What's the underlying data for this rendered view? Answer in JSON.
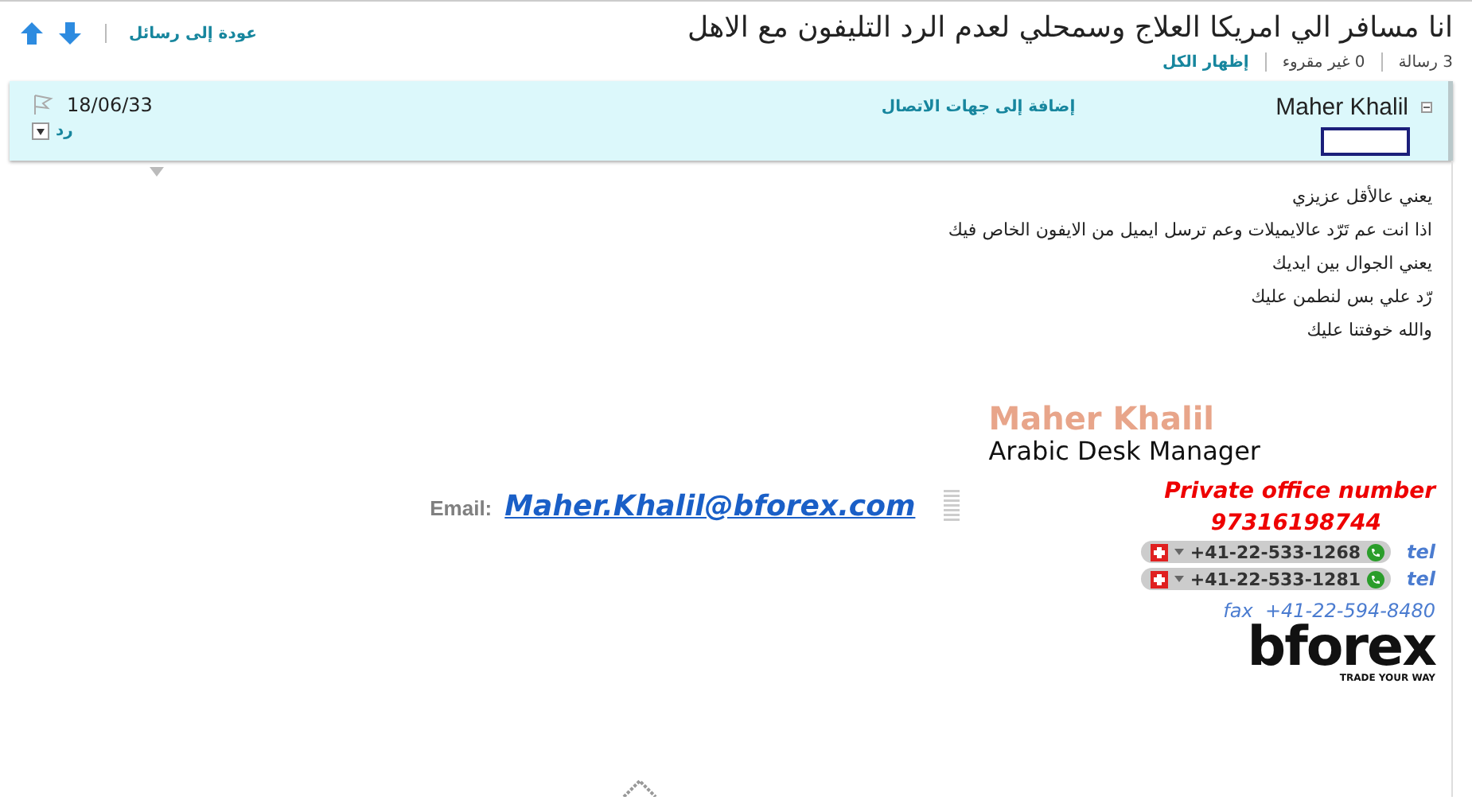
{
  "header": {
    "title": "انا مسافر الي امريكا العلاج وسمحلي لعدم الرد التليفون مع الاهل",
    "back_link": "عودة إلى رسائل",
    "stats": [
      {
        "text": "3 رسالة",
        "kind": "plain"
      },
      {
        "text": "0 غير مقروء",
        "kind": "plain"
      },
      {
        "text": "إظهار الكل",
        "kind": "link"
      }
    ]
  },
  "message": {
    "sender": "Maher Khalil",
    "add_contact": "إضافة إلى جهات الاتصال",
    "date": "18/06/33",
    "flagged": false,
    "reply": "رد",
    "expanded": true
  },
  "body": [
    "يعني عالأقل عزيزي",
    "اذا انت عم تَرّد عالايميلات وعم ترسل ايميل من الايفون الخاص فيك",
    "يعني الجوال بين ايديك",
    "رّد علي بس لنطمن عليك",
    "والله خوفتنا عليك"
  ],
  "signature": {
    "name": "Maher Khalil",
    "role": "Arabic Desk Manager",
    "email_label": "Email:",
    "email": "Maher.Khalil@bforex.com",
    "private_label": "Private office number",
    "private_number": "97316198744",
    "phones": [
      {
        "number": "+41-22-533-1268",
        "label": "tel"
      },
      {
        "number": "+41-22-533-1281",
        "label": "tel"
      }
    ],
    "fax_label": "fax",
    "fax": "+41-22-594-8480",
    "logo": "bforex",
    "tagline": "TRADE YOUR WAY"
  }
}
